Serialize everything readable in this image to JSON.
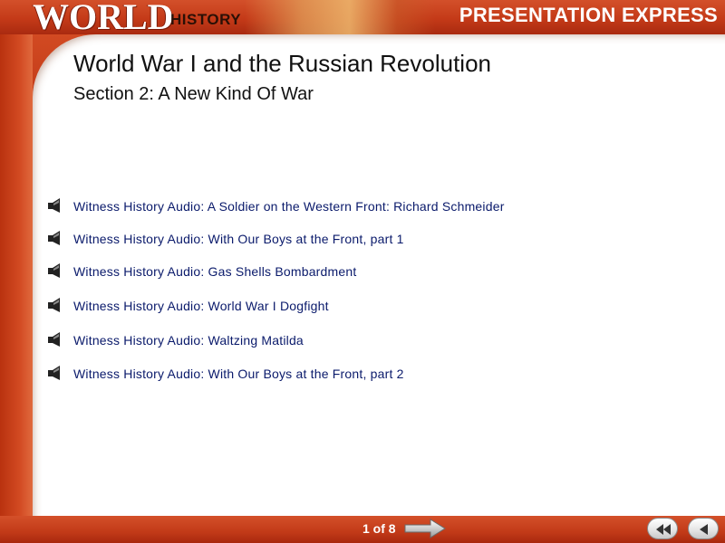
{
  "header": {
    "brand_world": "WORLD",
    "brand_history": "HISTORY",
    "presentation_express": "PRESENTATION EXPRESS"
  },
  "slide": {
    "title": "World War I and the Russian Revolution",
    "subtitle": "Section 2: A New Kind Of War"
  },
  "audio_items": [
    {
      "label": "Witness History Audio: A Soldier on the Western Front: Richard Schmeider",
      "icon": "speaker-icon"
    },
    {
      "label": "Witness History Audio: With Our Boys at the Front, part 1",
      "icon": "speaker-icon"
    },
    {
      "label": "Witness History Audio: Gas Shells Bombardment",
      "icon": "speaker-icon"
    },
    {
      "label": "Witness History Audio: World War I Dogfight",
      "icon": "speaker-icon"
    },
    {
      "label": "Witness History Audio: Waltzing Matilda",
      "icon": "speaker-icon"
    },
    {
      "label": "Witness History Audio: With Our Boys at the Front, part 2",
      "icon": "speaker-icon"
    }
  ],
  "footer": {
    "page_indicator": "1 of 8",
    "next_icon": "arrow-right-icon",
    "rewind_icon": "rewind-icon",
    "back_icon": "back-icon"
  },
  "colors": {
    "accent_red": "#c43a18",
    "link_blue": "#0a1a6b"
  }
}
